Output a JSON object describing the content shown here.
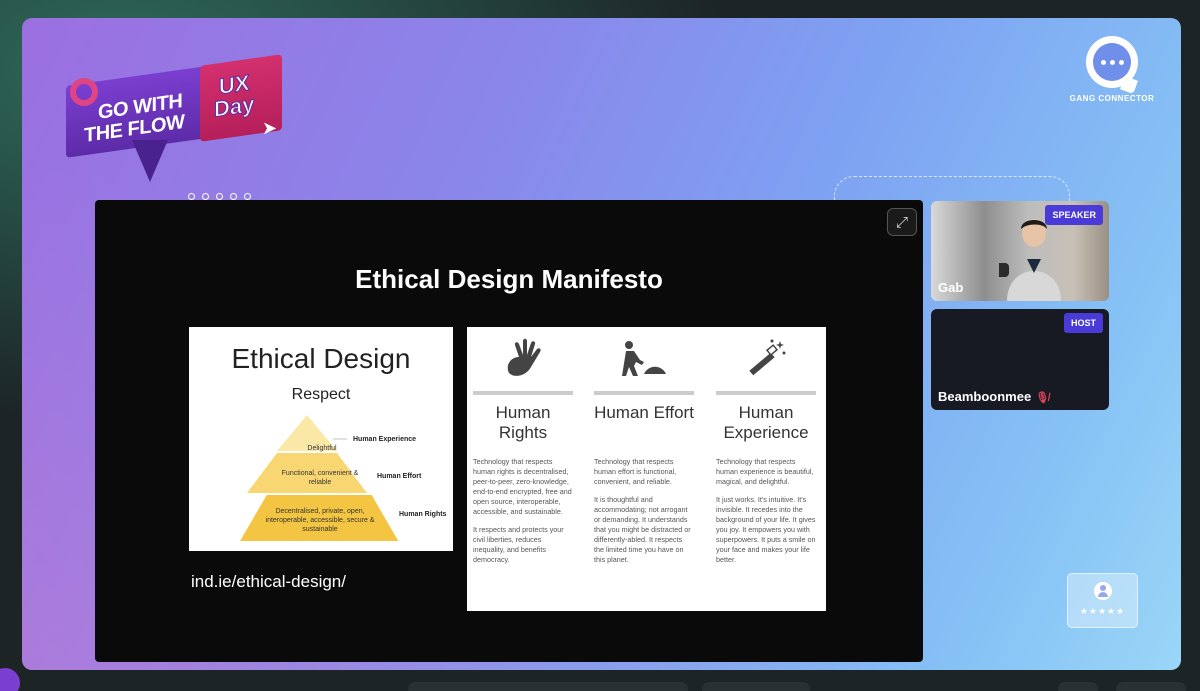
{
  "event": {
    "title_line1": "GO WITH",
    "title_line2": "THE FLOW",
    "badge_line1": "UX",
    "badge_line2": "Day"
  },
  "brand": {
    "logo_text": "GANG CONNECTOR"
  },
  "slide": {
    "title": "Ethical Design Manifesto",
    "url": "ind.ie/ethical-design/",
    "left_card": {
      "title": "Ethical Design",
      "subtitle": "Respect",
      "tiers": [
        {
          "text": "Delightful",
          "label": "Human Experience"
        },
        {
          "text": "Functional, convenient & reliable",
          "label": "Human Effort"
        },
        {
          "text": "Decentralised, private, open, interoperable, accessible, secure & sustainable",
          "label": "Human Rights"
        }
      ]
    },
    "columns": [
      {
        "icon": "hand-icon",
        "title": "Human Rights",
        "paragraphs": [
          "Technology that respects human rights is decentralised, peer-to-peer, zero-knowledge, end-to-end encrypted, free and open source, interoperable, accessible, and sustainable.",
          "It respects and protects your civil liberties, reduces inequality, and benefits democracy."
        ]
      },
      {
        "icon": "person-pushing-icon",
        "title": "Human Effort",
        "paragraphs": [
          "Technology that respects human effort is functional, convenient, and reliable.",
          "It is thoughtful and accommodating; not arrogant or demanding. It understands that you might be distracted or differently-abled. It respects the limited time you have on this planet."
        ]
      },
      {
        "icon": "magic-wand-icon",
        "title": "Human Experience",
        "paragraphs": [
          "Technology that respects human experience is beautiful, magical, and delightful.",
          "It just works. It's intuitive. It's invisible. It recedes into the background of your life. It gives you joy. It empowers you with superpowers. It puts a smile on your face and makes your life better."
        ]
      }
    ]
  },
  "participants": {
    "speaker": {
      "badge": "SPEAKER",
      "name": "Gab"
    },
    "host": {
      "badge": "HOST",
      "name": "Beamboonmee",
      "mic_muted": true
    }
  },
  "rating": {
    "stars": "★★★★★"
  },
  "colors": {
    "accent": "#4a3ad8",
    "stage_start": "#9c6fe0",
    "stage_end": "#9ad6f7"
  }
}
